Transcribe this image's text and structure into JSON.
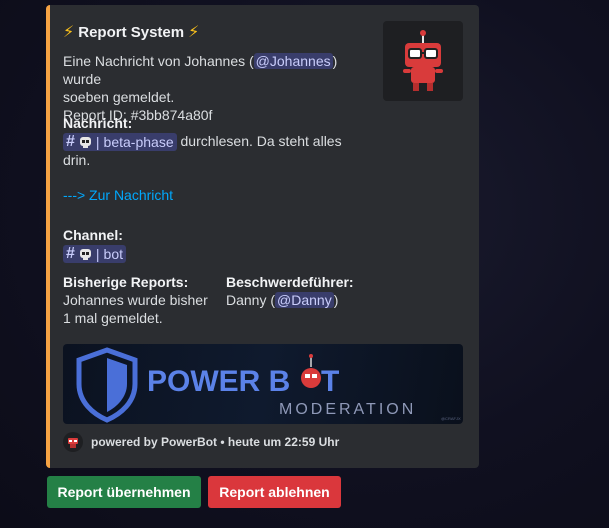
{
  "embed": {
    "accent_color": "#f5a243",
    "title": "Report System",
    "title_icon": "lightning-icon",
    "description": {
      "line1_prefix": "Eine Nachricht von Johannes (",
      "mention_johannes": "@Johannes",
      "line1_suffix": ") wurde",
      "line2": "soeben gemeldet.",
      "report_id": "Report ID: #3bb874a80f"
    },
    "nachricht": {
      "label": "Nachricht:",
      "channel_name": "beta-phase",
      "text_line1": " durchlesen. Da steht alles",
      "text_line2": "drin.",
      "link": "---> Zur Nachricht"
    },
    "channel": {
      "label": "Channel:",
      "channel_name": "bot"
    },
    "fields": {
      "reports_label": "Bisherige Reports:",
      "reports_value_line1": "Johannes wurde bisher",
      "reports_value_line2": "1 mal gemeldet.",
      "complainant_label": "Beschwerdeführer:",
      "complainant_prefix": "Danny (",
      "mention_danny": "@Danny",
      "complainant_suffix": ")"
    },
    "banner": {
      "brand_part1": "POWER B",
      "brand_part2": "T",
      "subtitle": "MODERATION",
      "credit": "@CRAFJX"
    },
    "footer": {
      "text": "powered by PowerBot • heute um 22:59 Uhr"
    }
  },
  "buttons": {
    "accept_label": "Report übernehmen",
    "reject_label": "Report ablehnen",
    "accept_color": "#248046",
    "reject_color": "#da373c"
  }
}
